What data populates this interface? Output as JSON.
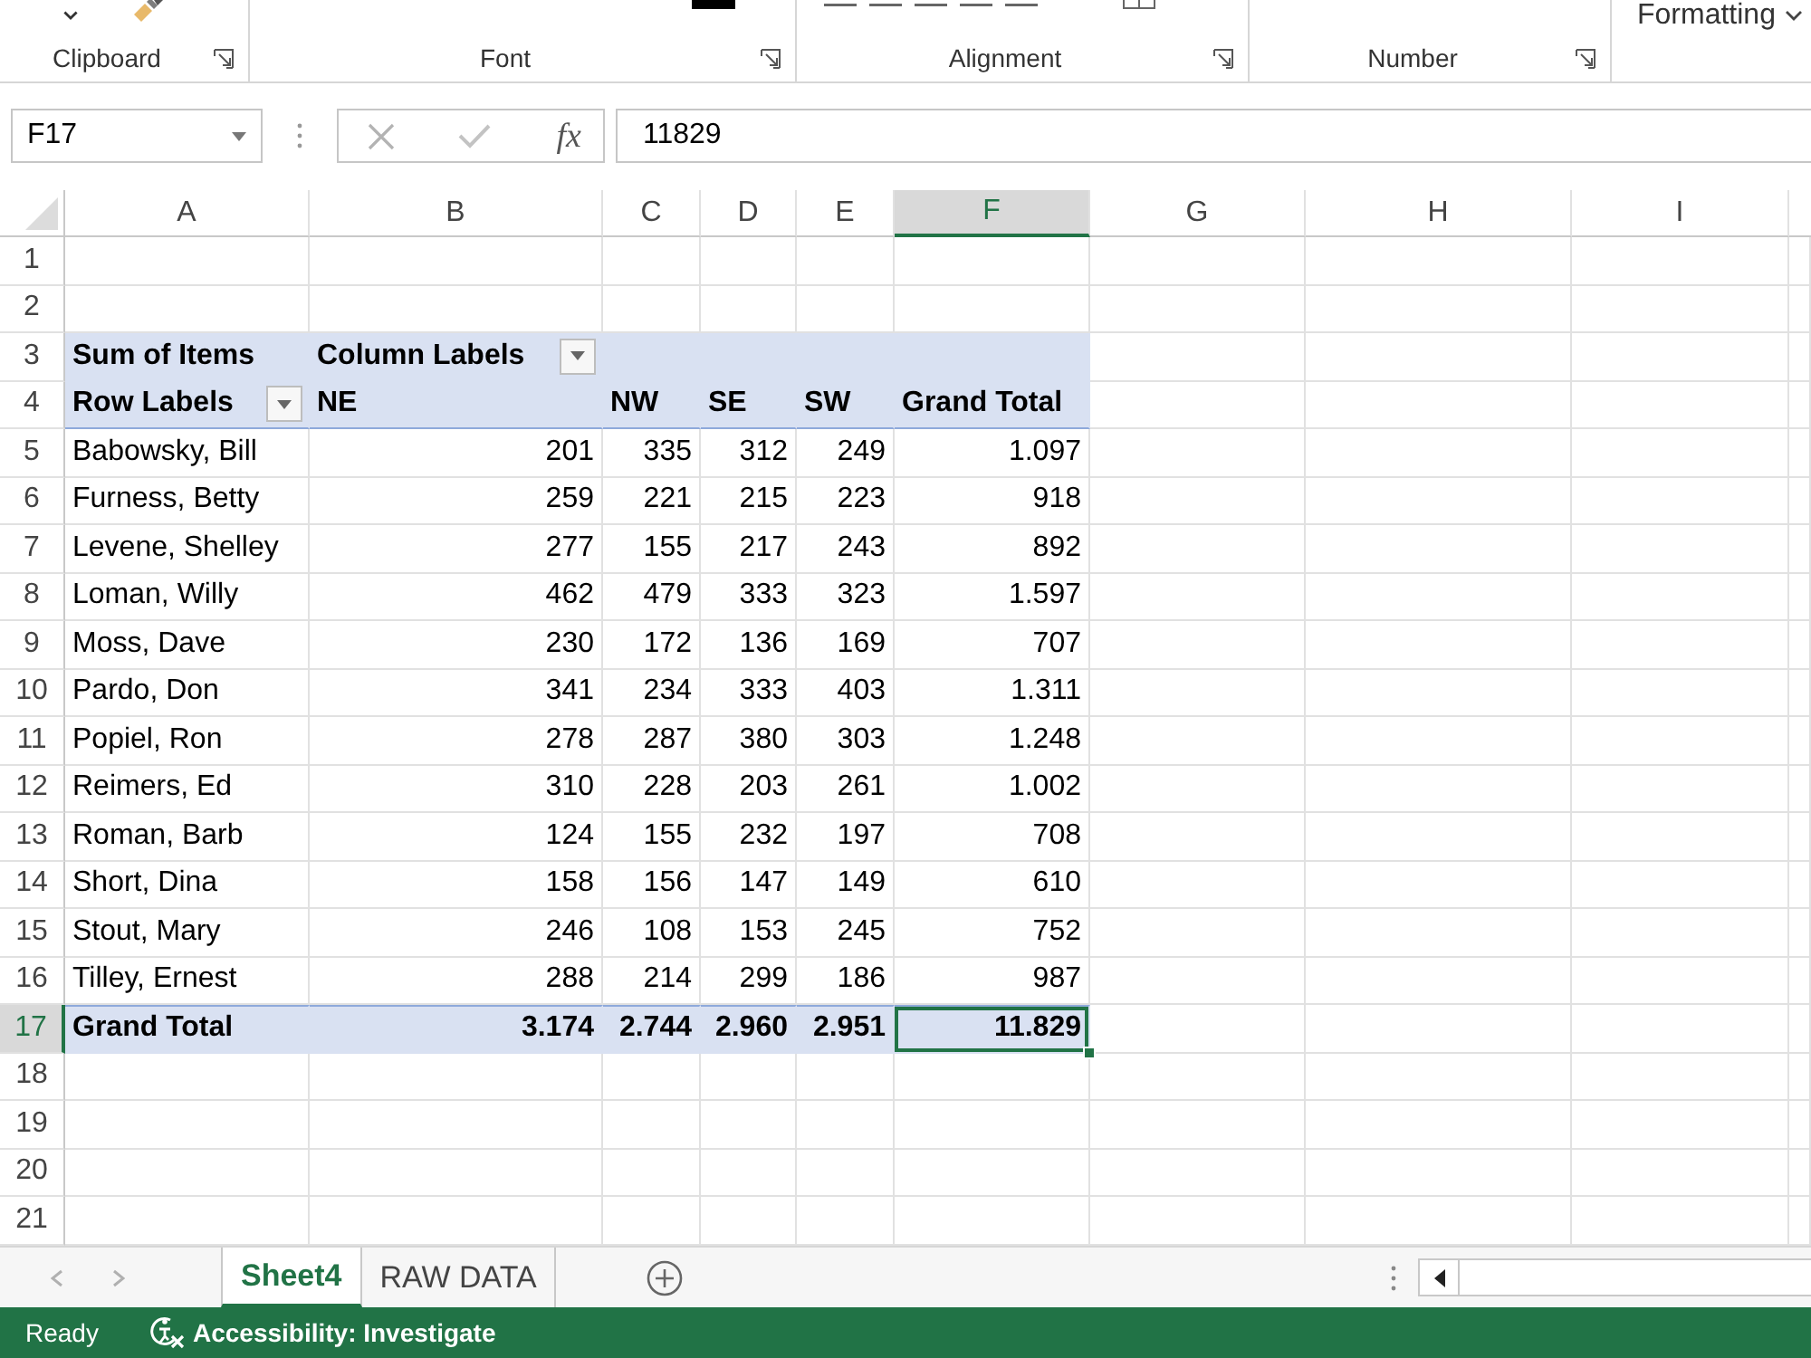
{
  "ribbon": {
    "groups": [
      "Clipboard",
      "Font",
      "Alignment",
      "Number"
    ],
    "styles_button": "Formatting"
  },
  "formula_bar": {
    "name_box": "F17",
    "function_label": "fx",
    "value": "11829"
  },
  "sheet": {
    "columns": [
      {
        "label": "A",
        "selected": false
      },
      {
        "label": "B",
        "selected": false
      },
      {
        "label": "C",
        "selected": false
      },
      {
        "label": "D",
        "selected": false
      },
      {
        "label": "E",
        "selected": false
      },
      {
        "label": "F",
        "selected": true
      },
      {
        "label": "G",
        "selected": false
      },
      {
        "label": "H",
        "selected": false
      },
      {
        "label": "I",
        "selected": false
      }
    ],
    "rows": [
      {
        "label": "1",
        "selected": false,
        "kind": "blank"
      },
      {
        "label": "2",
        "selected": false,
        "kind": "blank"
      },
      {
        "label": "3",
        "selected": false,
        "kind": "pivot_title",
        "value_field": "Sum of Items",
        "column_field": "Column Labels"
      },
      {
        "label": "4",
        "selected": false,
        "kind": "pivot_columns",
        "row_field": "Row Labels",
        "columns": [
          "NE",
          "NW",
          "SE",
          "SW",
          "Grand Total"
        ]
      },
      {
        "label": "5",
        "selected": false,
        "kind": "data",
        "name": "Babowsky, Bill",
        "values": [
          "201",
          "335",
          "312",
          "249",
          "1.097"
        ]
      },
      {
        "label": "6",
        "selected": false,
        "kind": "data",
        "name": "Furness, Betty",
        "values": [
          "259",
          "221",
          "215",
          "223",
          "918"
        ]
      },
      {
        "label": "7",
        "selected": false,
        "kind": "data",
        "name": "Levene, Shelley",
        "values": [
          "277",
          "155",
          "217",
          "243",
          "892"
        ]
      },
      {
        "label": "8",
        "selected": false,
        "kind": "data",
        "name": "Loman, Willy",
        "values": [
          "462",
          "479",
          "333",
          "323",
          "1.597"
        ]
      },
      {
        "label": "9",
        "selected": false,
        "kind": "data",
        "name": "Moss, Dave",
        "values": [
          "230",
          "172",
          "136",
          "169",
          "707"
        ]
      },
      {
        "label": "10",
        "selected": false,
        "kind": "data",
        "name": "Pardo, Don",
        "values": [
          "341",
          "234",
          "333",
          "403",
          "1.311"
        ]
      },
      {
        "label": "11",
        "selected": false,
        "kind": "data",
        "name": "Popiel, Ron",
        "values": [
          "278",
          "287",
          "380",
          "303",
          "1.248"
        ]
      },
      {
        "label": "12",
        "selected": false,
        "kind": "data",
        "name": "Reimers, Ed",
        "values": [
          "310",
          "228",
          "203",
          "261",
          "1.002"
        ]
      },
      {
        "label": "13",
        "selected": false,
        "kind": "data",
        "name": "Roman, Barb",
        "values": [
          "124",
          "155",
          "232",
          "197",
          "708"
        ]
      },
      {
        "label": "14",
        "selected": false,
        "kind": "data",
        "name": "Short, Dina",
        "values": [
          "158",
          "156",
          "147",
          "149",
          "610"
        ]
      },
      {
        "label": "15",
        "selected": false,
        "kind": "data",
        "name": "Stout, Mary",
        "values": [
          "246",
          "108",
          "153",
          "245",
          "752"
        ]
      },
      {
        "label": "16",
        "selected": false,
        "kind": "data",
        "name": "Tilley, Ernest",
        "values": [
          "288",
          "214",
          "299",
          "186",
          "987"
        ]
      },
      {
        "label": "17",
        "selected": true,
        "kind": "total",
        "name": "Grand Total",
        "values": [
          "3.174",
          "2.744",
          "2.960",
          "2.951",
          "11.829"
        ]
      },
      {
        "label": "18",
        "selected": false,
        "kind": "blank"
      },
      {
        "label": "19",
        "selected": false,
        "kind": "blank"
      },
      {
        "label": "20",
        "selected": false,
        "kind": "blank"
      },
      {
        "label": "21",
        "selected": false,
        "kind": "blank"
      }
    ]
  },
  "sheet_tabs": [
    {
      "label": "Sheet4",
      "selected": true
    },
    {
      "label": "RAW DATA",
      "selected": false
    }
  ],
  "status_bar": {
    "mode": "Ready",
    "accessibility": "Accessibility: Investigate"
  }
}
